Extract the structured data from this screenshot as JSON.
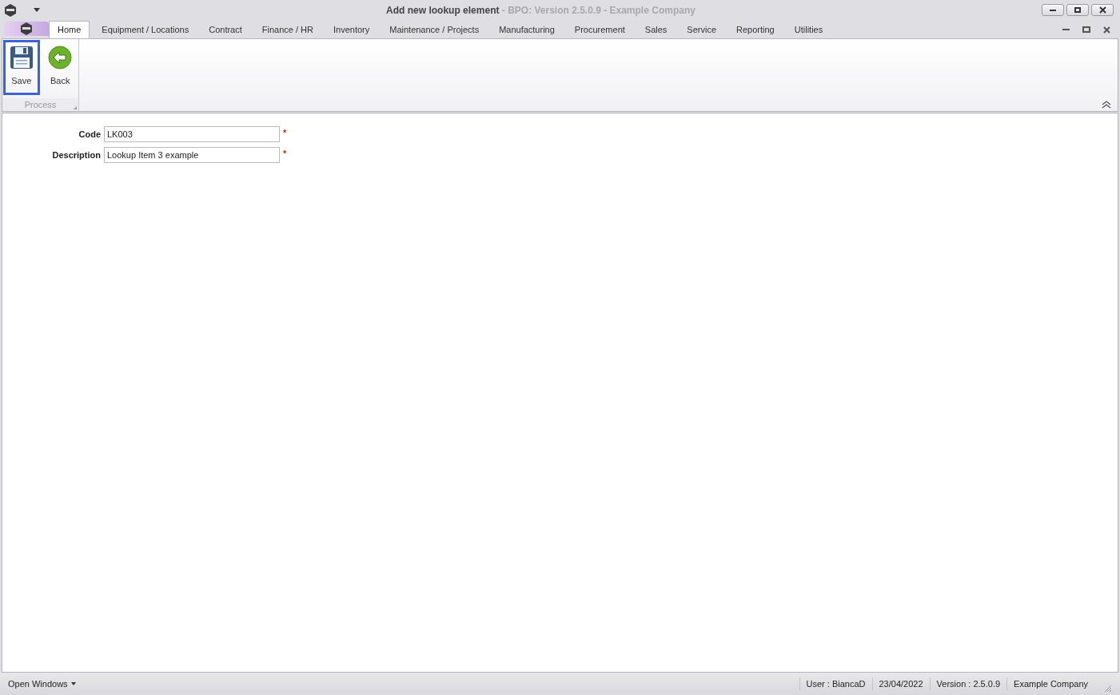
{
  "window": {
    "title": "Add new lookup element",
    "subtitle": " - BPO: Version 2.5.0.9 - Example Company"
  },
  "tabs": [
    {
      "label": "Home",
      "selected": true
    },
    {
      "label": "Equipment / Locations",
      "selected": false
    },
    {
      "label": "Contract",
      "selected": false
    },
    {
      "label": "Finance / HR",
      "selected": false
    },
    {
      "label": "Inventory",
      "selected": false
    },
    {
      "label": "Maintenance / Projects",
      "selected": false
    },
    {
      "label": "Manufacturing",
      "selected": false
    },
    {
      "label": "Procurement",
      "selected": false
    },
    {
      "label": "Sales",
      "selected": false
    },
    {
      "label": "Service",
      "selected": false
    },
    {
      "label": "Reporting",
      "selected": false
    },
    {
      "label": "Utilities",
      "selected": false
    }
  ],
  "ribbon": {
    "group": "Process",
    "buttons": [
      {
        "label": "Save",
        "kind": "save",
        "selected": true
      },
      {
        "label": "Back",
        "kind": "back",
        "selected": false
      }
    ]
  },
  "form": {
    "fields": [
      {
        "label": "Code",
        "value": "LK003",
        "required_mark": "*"
      },
      {
        "label": "Description",
        "value": "Lookup Item 3 example",
        "required_mark": "*"
      }
    ]
  },
  "status_bar": {
    "open_windows": "Open Windows",
    "items": [
      "User : BiancaD",
      "23/04/2022",
      "Version : 2.5.0.9",
      "Example Company"
    ]
  }
}
